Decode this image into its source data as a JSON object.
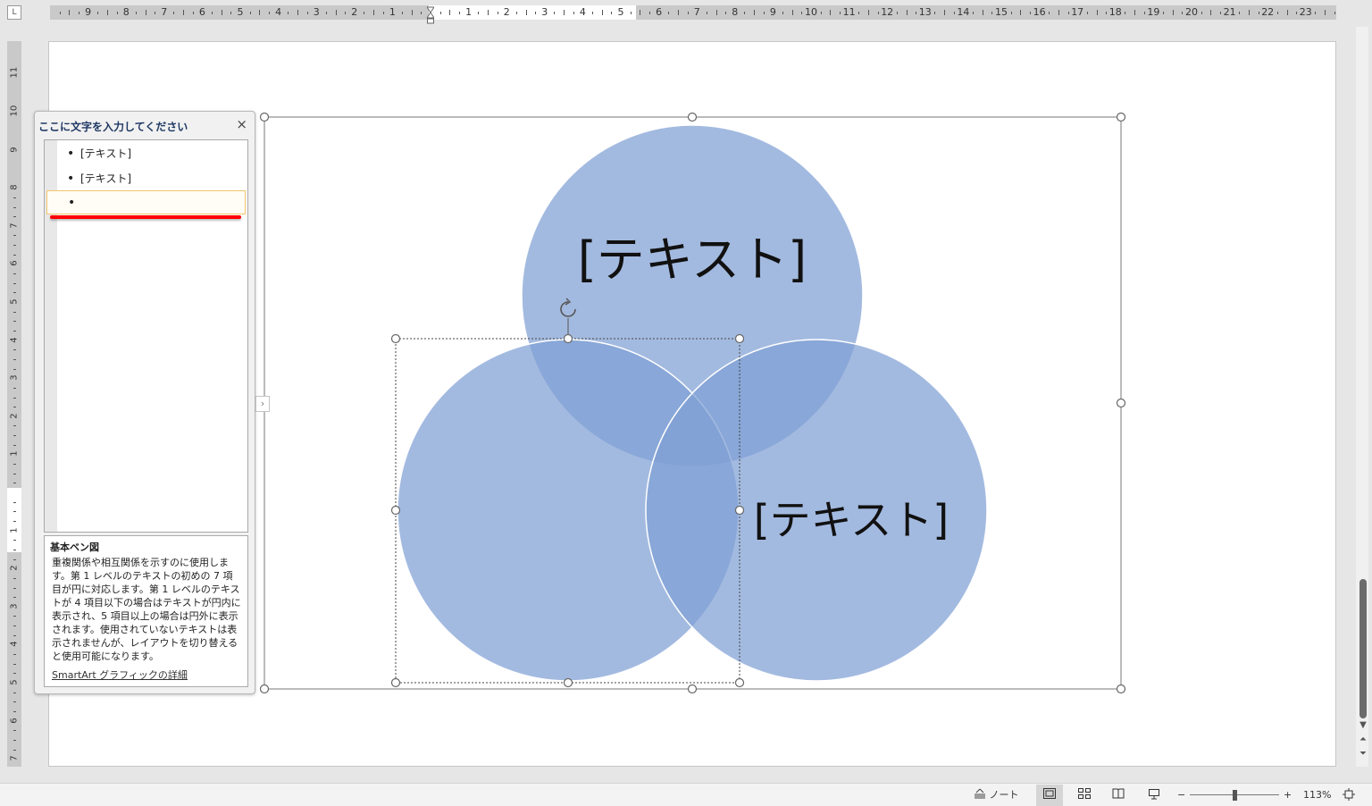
{
  "ruler": {
    "horizontal_labels": [
      "9",
      "8",
      "7",
      "6",
      "5",
      "4",
      "3",
      "2",
      "1",
      "1",
      "2",
      "3",
      "4",
      "5",
      "6",
      "7",
      "8",
      "9",
      "10",
      "11",
      "12",
      "13",
      "14",
      "15",
      "16",
      "17",
      "18",
      "19",
      "20",
      "21",
      "22",
      "23"
    ],
    "vertical_labels": [
      "11",
      "10",
      "9",
      "8",
      "7",
      "6",
      "5",
      "4",
      "3",
      "2",
      "1",
      "1",
      "2",
      "3",
      "4",
      "5",
      "6",
      "7"
    ]
  },
  "text_pane": {
    "title": "ここに文字を入力してください",
    "close_glyph": "×",
    "items": [
      "[テキスト]",
      "[テキスト]",
      ""
    ],
    "description": {
      "title": "基本ベン図",
      "body": "重複関係や相互関係を示すのに使用します。第 1 レベルのテキストの初めの 7 項目が円に対応します。第 1 レベルのテキストが 4 項目以下の場合はテキストが円内に表示され、5 項目以上の場合は円外に表示されます。使用されていないテキストは表示されませんが、レイアウトを切り替えると使用可能になります。",
      "link": "SmartArt グラフィックの詳細"
    },
    "toggle_glyph": "›"
  },
  "smartart": {
    "circle_color": "#7f9fd4",
    "circles": [
      {
        "label": "[テキスト]"
      },
      {
        "label": ""
      },
      {
        "label": "[テキスト]"
      }
    ]
  },
  "scrollbar": {
    "down_glyph": "▼",
    "prev_glyph": "⏶",
    "next_glyph": "⏷"
  },
  "statusbar": {
    "notes_label": "ノート",
    "zoom_minus": "−",
    "zoom_plus": "+",
    "zoom_level": "113%",
    "zoom_fraction": 0.5
  }
}
